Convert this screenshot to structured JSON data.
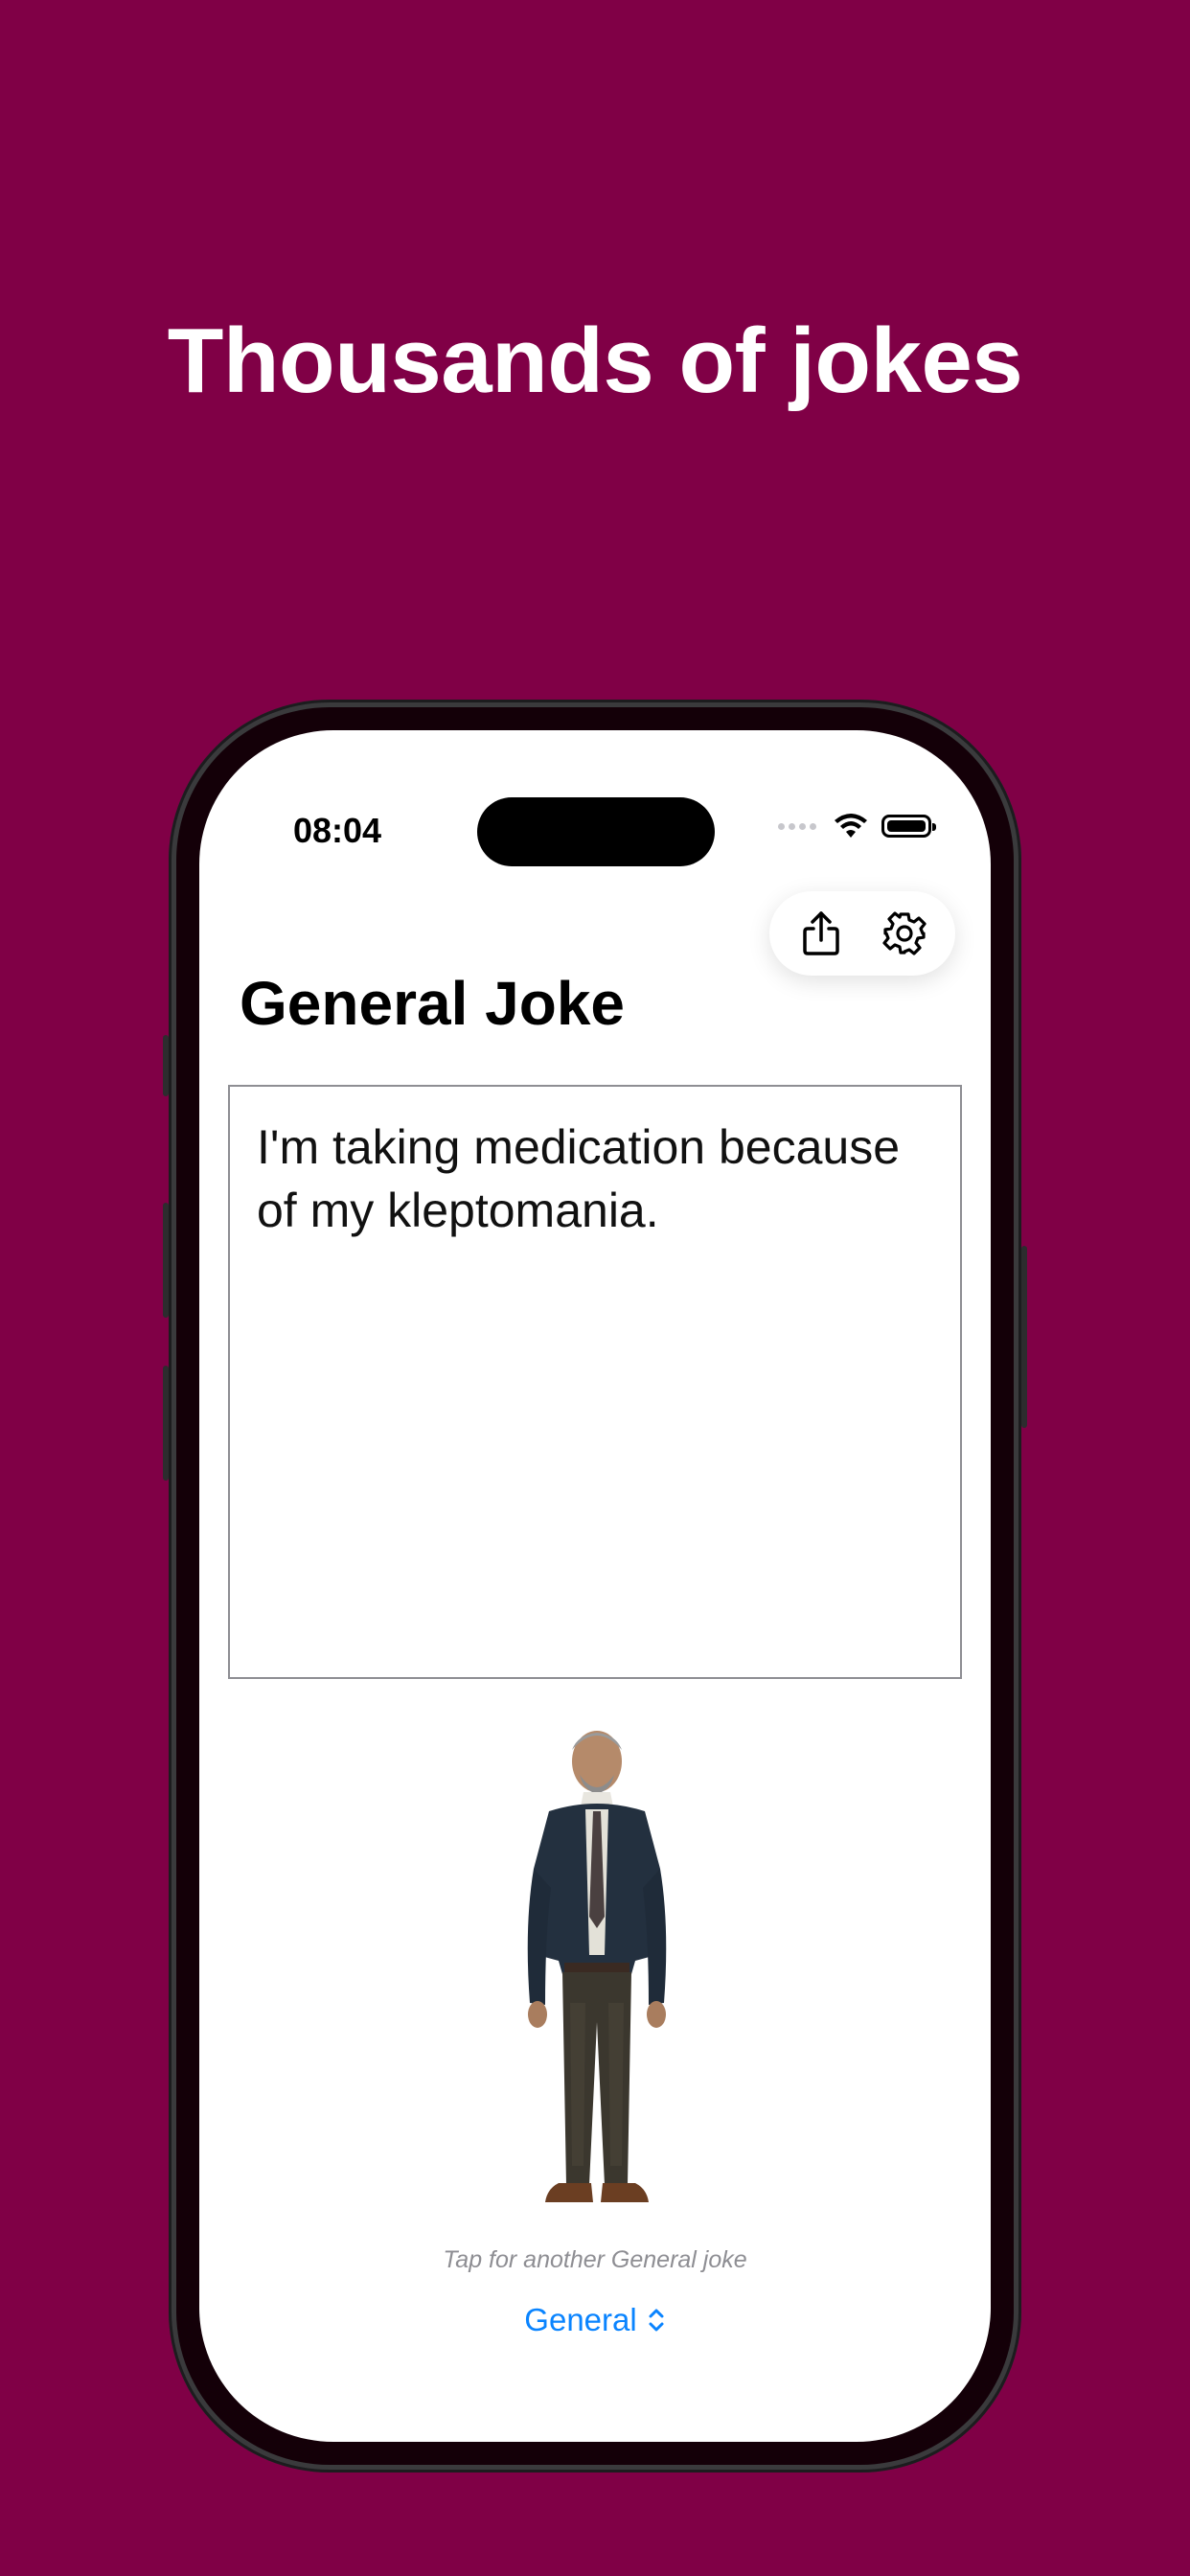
{
  "headline": "Thousands of jokes",
  "status_bar": {
    "time": "08:04"
  },
  "toolbar": {
    "share_icon": "share-icon",
    "settings_icon": "gear-icon"
  },
  "page_title": "General Joke",
  "joke_text": "I'm taking medication because of my kleptomania.",
  "caption": "Tap for another General joke",
  "category_picker": {
    "label": "General",
    "icon": "chevron-up-down-icon"
  },
  "colors": {
    "background": "#800046",
    "accent": "#0a84ff"
  }
}
